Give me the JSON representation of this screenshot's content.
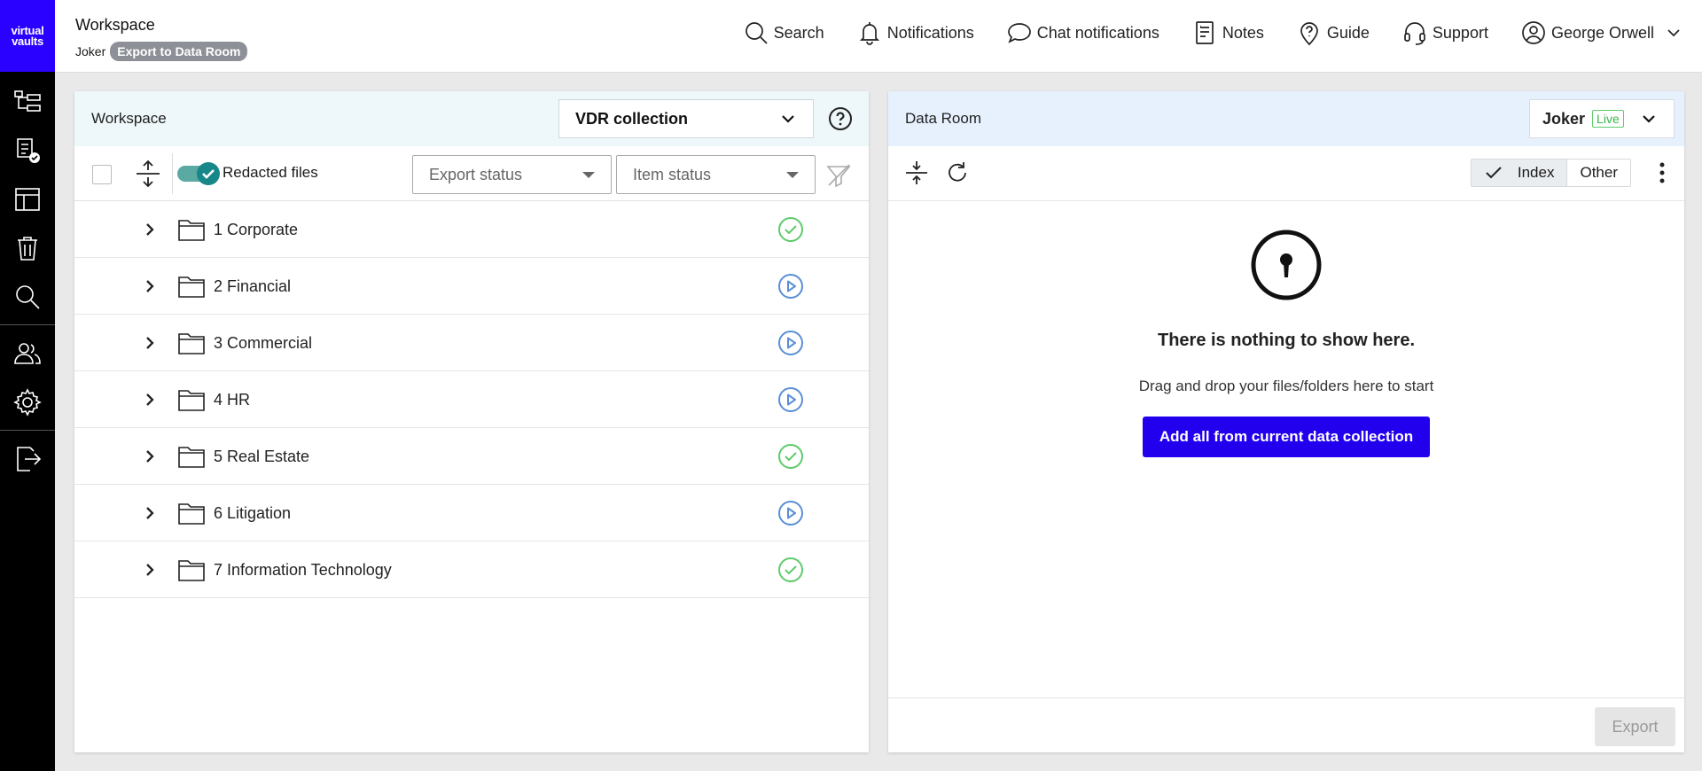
{
  "app": {
    "logo_line1": "virtual",
    "logo_line2": "vaults"
  },
  "header": {
    "title": "Workspace",
    "subtitle": "Joker",
    "badge": "Export to Data Room",
    "nav": {
      "search": "Search",
      "notifications": "Notifications",
      "chat": "Chat notifications",
      "notes": "Notes",
      "guide": "Guide",
      "support": "Support",
      "user": "George Orwell"
    }
  },
  "workspace": {
    "title": "Workspace",
    "collection": "VDR collection",
    "toggle_label": "Redacted files",
    "toggle_on": true,
    "export_status_placeholder": "Export status",
    "item_status_placeholder": "Item status",
    "folders": [
      {
        "label": "1 Corporate",
        "status": "done"
      },
      {
        "label": "2 Financial",
        "status": "pending"
      },
      {
        "label": "3 Commercial",
        "status": "pending"
      },
      {
        "label": "4 HR",
        "status": "pending"
      },
      {
        "label": "5 Real Estate",
        "status": "done"
      },
      {
        "label": "6 Litigation",
        "status": "pending"
      },
      {
        "label": "7 Information Technology",
        "status": "done"
      }
    ]
  },
  "dataroom": {
    "title": "Data Room",
    "room_name": "Joker",
    "room_badge": "Live",
    "seg_index": "Index",
    "seg_other": "Other",
    "empty_title": "There is nothing to show here.",
    "empty_sub": "Drag and drop your files/folders here to start",
    "add_all": "Add all from current data collection",
    "export": "Export"
  },
  "colors": {
    "brand": "#2a00ff",
    "done": "#5ecb6b",
    "pending": "#5b8fd6",
    "toggle": "#17878a"
  }
}
